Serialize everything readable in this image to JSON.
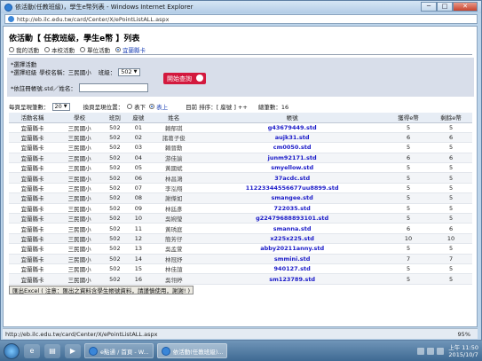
{
  "window": {
    "title": "依活動(任教班級)，學生e幣列表 - Windows Internet Explorer",
    "address": "http://eb.ilc.edu.tw/card/Center/X/ePointListALL.aspx",
    "btn_min": "─",
    "btn_max": "□",
    "btn_close": "✕"
  },
  "page": {
    "heading": "依活動【 任教班級，學生e幣 】列表",
    "tabs": [
      {
        "label": "我的活動"
      },
      {
        "label": "本校活動"
      },
      {
        "label": "單位活動"
      },
      {
        "label": "宜蘭縣卡"
      }
    ],
    "filter": {
      "activity_label": "*選擇活動",
      "class_label": "*選擇班級",
      "school_name_label": "學校名稱：",
      "school_name_value": "三民國小",
      "class_field_label": "班級：",
      "class_value": "502",
      "search_label": "*依註冊帳號.std／姓名：",
      "query_button": "開始查詢"
    },
    "controls": {
      "per_page_label": "每頁呈現筆數：",
      "per_page_value": "20",
      "sort_label": "換頁呈現位置：",
      "sort_down": "表下",
      "sort_up": "表上",
      "order_label": "目前 排序：[ 座號 ] ++",
      "total_label": "總筆數：16"
    },
    "table": {
      "headers": [
        "活動名稱",
        "學校",
        "班別",
        "座號",
        "姓名",
        "帳號",
        "獲得e幣",
        "剩餘e幣"
      ],
      "rows": [
        [
          "宜蘭縣卡",
          "三民國小",
          "502",
          "01",
          "賴郁琪",
          "g43679449.std",
          "5",
          "5"
        ],
        [
          "宜蘭縣卡",
          "三民國小",
          "502",
          "02",
          "諸葛子俊",
          "aujk31.std",
          "6",
          "6"
        ],
        [
          "宜蘭縣卡",
          "三民國小",
          "502",
          "03",
          "賴晉勳",
          "cm0050.std",
          "5",
          "5"
        ],
        [
          "宜蘭縣卡",
          "三民國小",
          "502",
          "04",
          "游佳諭",
          "junm92171.std",
          "6",
          "6"
        ],
        [
          "宜蘭縣卡",
          "三民國小",
          "502",
          "05",
          "黃國斌",
          "smyellow.std",
          "5",
          "5"
        ],
        [
          "宜蘭縣卡",
          "三民國小",
          "502",
          "06",
          "林昌鴻",
          "37acdc.std",
          "5",
          "5"
        ],
        [
          "宜蘭縣卡",
          "三民國小",
          "502",
          "07",
          "李泓翔",
          "11223344556677uu8899.std",
          "5",
          "5"
        ],
        [
          "宜蘭縣卡",
          "三民國小",
          "502",
          "08",
          "謝傑如",
          "smangee.std",
          "5",
          "5"
        ],
        [
          "宜蘭縣卡",
          "三民國小",
          "502",
          "09",
          "林廷彥",
          "722035.std",
          "5",
          "5"
        ],
        [
          "宜蘭縣卡",
          "三民國小",
          "502",
          "10",
          "吳婉瑩",
          "g22479688893101.std",
          "5",
          "5"
        ],
        [
          "宜蘭縣卡",
          "三民國小",
          "502",
          "11",
          "黃琇庭",
          "smanna.std",
          "6",
          "6"
        ],
        [
          "宜蘭縣卡",
          "三民國小",
          "502",
          "12",
          "簡芳仔",
          "x225x225.std",
          "10",
          "10"
        ],
        [
          "宜蘭縣卡",
          "三民國小",
          "502",
          "13",
          "吳孟萱",
          "abby20211anny.std",
          "5",
          "5"
        ],
        [
          "宜蘭縣卡",
          "三民國小",
          "502",
          "14",
          "林冠妤",
          "smmini.std",
          "7",
          "7"
        ],
        [
          "宜蘭縣卡",
          "三民國小",
          "502",
          "15",
          "林佳諠",
          "940127.std",
          "5",
          "5"
        ],
        [
          "宜蘭縣卡",
          "三民國小",
          "502",
          "16",
          "吳翎婷",
          "sm123789.std",
          "5",
          "5"
        ]
      ]
    },
    "excel_button": "匯出Excel ( 注意：匯出之資料含學生帳號資料，請謹慎使用，謝謝! )"
  },
  "statusbar": {
    "url": "http://eb.ilc.edu.tw/card/Center/X/ePointListALL.aspx",
    "zoom": "95%"
  },
  "taskbar": {
    "tasks": [
      {
        "label": "e點通 / 首頁 - W..."
      },
      {
        "label": "依活動(任教班級)..."
      }
    ],
    "time": "上午 11:50",
    "date": "2015/10/7"
  },
  "colors": {
    "query_button_bg": "#d3193e",
    "account_text": "#1a1ac8"
  }
}
